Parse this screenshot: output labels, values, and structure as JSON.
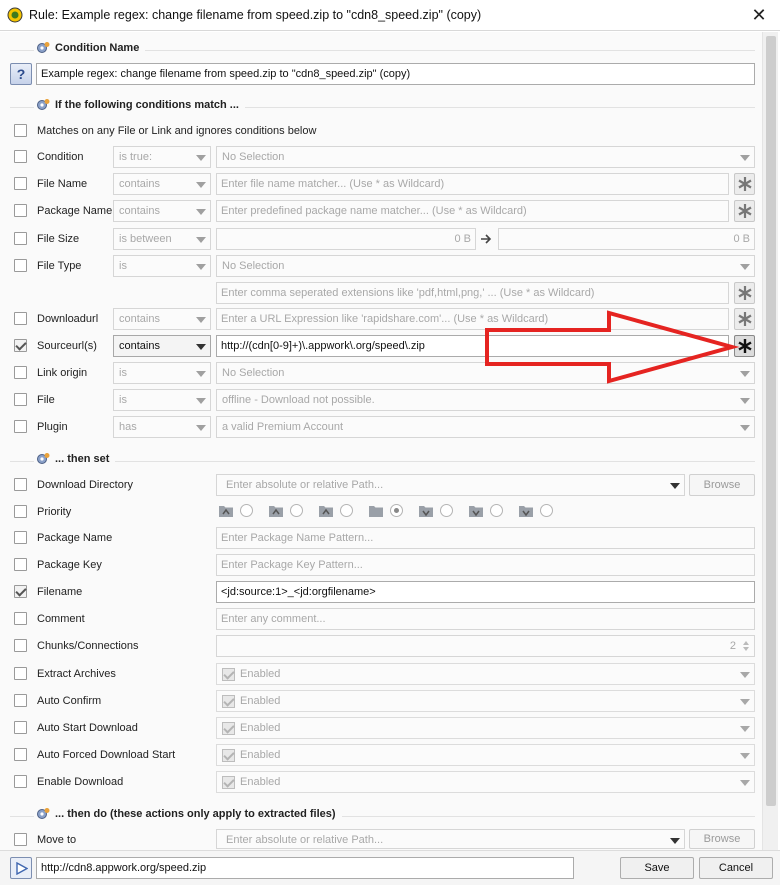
{
  "window": {
    "title": "Rule: Example regex: change filename from speed.zip to \"cdn8_speed.zip\" (copy)",
    "close_glyph": "✕"
  },
  "condition_name": {
    "header": "Condition Name",
    "help_glyph": "?",
    "value": "Example regex: change filename from speed.zip to \"cdn8_speed.zip\" (copy)"
  },
  "conditions": {
    "header": "If the following conditions match ...",
    "matches_any": "Matches on any File or Link and ignores conditions below",
    "rows": [
      {
        "label": "Condition",
        "op": "is true:",
        "value": "No Selection",
        "checked": false
      },
      {
        "label": "File Name",
        "op": "contains",
        "placeholder": "Enter file name matcher... (Use * as Wildcard)",
        "checked": false
      },
      {
        "label": "Package Name",
        "op": "contains",
        "placeholder": "Enter predefined package name matcher... (Use * as Wildcard)",
        "checked": false
      },
      {
        "label": "File Size",
        "op": "is between",
        "min": "0 B",
        "max": "0 B",
        "checked": false
      },
      {
        "label": "File Type",
        "op": "is",
        "value": "No Selection",
        "extensions_placeholder": "Enter comma seperated extensions like 'pdf,html,png,' ... (Use * as Wildcard)",
        "checked": false
      },
      {
        "label": "Downloadurl",
        "op": "contains",
        "placeholder": "Enter a URL Expression like 'rapidshare.com'... (Use * as Wildcard)",
        "checked": false
      },
      {
        "label": "Sourceurl(s)",
        "op": "contains",
        "value": "http://(cdn[0-9]+)\\.appwork\\.org/speed\\.zip",
        "checked": true
      },
      {
        "label": "Link origin",
        "op": "is",
        "value": "No Selection",
        "checked": false
      },
      {
        "label": "File",
        "op": "is",
        "value": "offline - Download not possible.",
        "checked": false
      },
      {
        "label": "Plugin",
        "op": "has",
        "value": "a valid Premium Account",
        "checked": false
      }
    ]
  },
  "then_set": {
    "header": "... then set",
    "rows": [
      {
        "label": "Download Directory",
        "placeholder": "Enter absolute or relative Path...",
        "button": "Browse",
        "checked": false
      },
      {
        "label": "Priority",
        "checked": false,
        "selected_index": 3
      },
      {
        "label": "Package Name",
        "placeholder": "Enter Package Name Pattern...",
        "checked": false
      },
      {
        "label": "Package Key",
        "placeholder": "Enter Package Key Pattern...",
        "checked": false
      },
      {
        "label": "Filename",
        "value": "<jd:source:1>_<jd:orgfilename>",
        "checked": true
      },
      {
        "label": "Comment",
        "placeholder": "Enter any comment...",
        "checked": false
      },
      {
        "label": "Chunks/Connections",
        "value": "2",
        "checked": false
      },
      {
        "label": "Extract Archives",
        "value": "Enabled",
        "checked": false
      },
      {
        "label": "Auto Confirm",
        "value": "Enabled",
        "checked": false
      },
      {
        "label": "Auto Start Download",
        "value": "Enabled",
        "checked": false
      },
      {
        "label": "Auto Forced Download Start",
        "value": "Enabled",
        "checked": false
      },
      {
        "label": "Enable Download",
        "value": "Enabled",
        "checked": false
      }
    ]
  },
  "then_do": {
    "header": "... then do (these actions only apply to extracted files)",
    "rows": [
      {
        "label": "Move to",
        "placeholder": "Enter absolute or relative Path...",
        "button": "Browse",
        "checked": false
      }
    ]
  },
  "footer": {
    "test_url": "http://cdn8.appwork.org/speed.zip",
    "save": "Save",
    "cancel": "Cancel"
  },
  "colors": {
    "annotation_arrow": "#e52421",
    "help_button": "#2b4a8c"
  },
  "icons": {
    "app": "jdownloader-logo-icon",
    "section": "gear-icon",
    "regex": "asterisk-icon",
    "play": "play-icon"
  }
}
